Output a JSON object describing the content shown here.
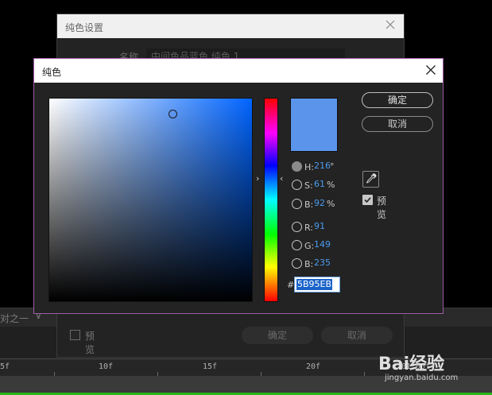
{
  "outer_dialog": {
    "title": "纯色设置",
    "name_label": "名称",
    "name_value": "中间色品蓝色 纯色 1",
    "preview_label": "预览",
    "ok_label": "确定",
    "cancel_label": "取消"
  },
  "picker": {
    "title": "纯色",
    "ok_label": "确定",
    "cancel_label": "取消",
    "preview_label": "预览",
    "preview_checked": true,
    "swatch_color": "#5B95EB",
    "h": {
      "label": "H:",
      "value": "216",
      "unit": "°"
    },
    "s": {
      "label": "S:",
      "value": "61",
      "unit": "%"
    },
    "bright": {
      "label": "B:",
      "value": "92",
      "unit": "%"
    },
    "r": {
      "label": "R:",
      "value": "91"
    },
    "g": {
      "label": "G:",
      "value": "149"
    },
    "b": {
      "label": "B:",
      "value": "235"
    },
    "hex_hash": "#",
    "hex_value": "5B95EB",
    "selected_mode": "H",
    "sv_marker": {
      "saturation": 0.61,
      "brightness": 0.92
    },
    "hue_marker": {
      "hue_degrees": 216
    }
  },
  "background": {
    "row_text": "对之一",
    "timeline_ticks": [
      "5f",
      "10f",
      "15f",
      "20f",
      "01:00f"
    ]
  },
  "watermark": {
    "brand": "Bai经验",
    "sub": "jingyan.baidu.com"
  },
  "icons": {
    "close": "close-icon",
    "eyedropper": "eyedropper-icon",
    "chevron": "chevron-down-icon",
    "hue_arrows": "hue-slider-arrow-icon"
  },
  "colors": {
    "accent_value_blue": "#4a9cf0",
    "picker_border": "#a05aa8",
    "timeline_green": "#2bb51b"
  }
}
